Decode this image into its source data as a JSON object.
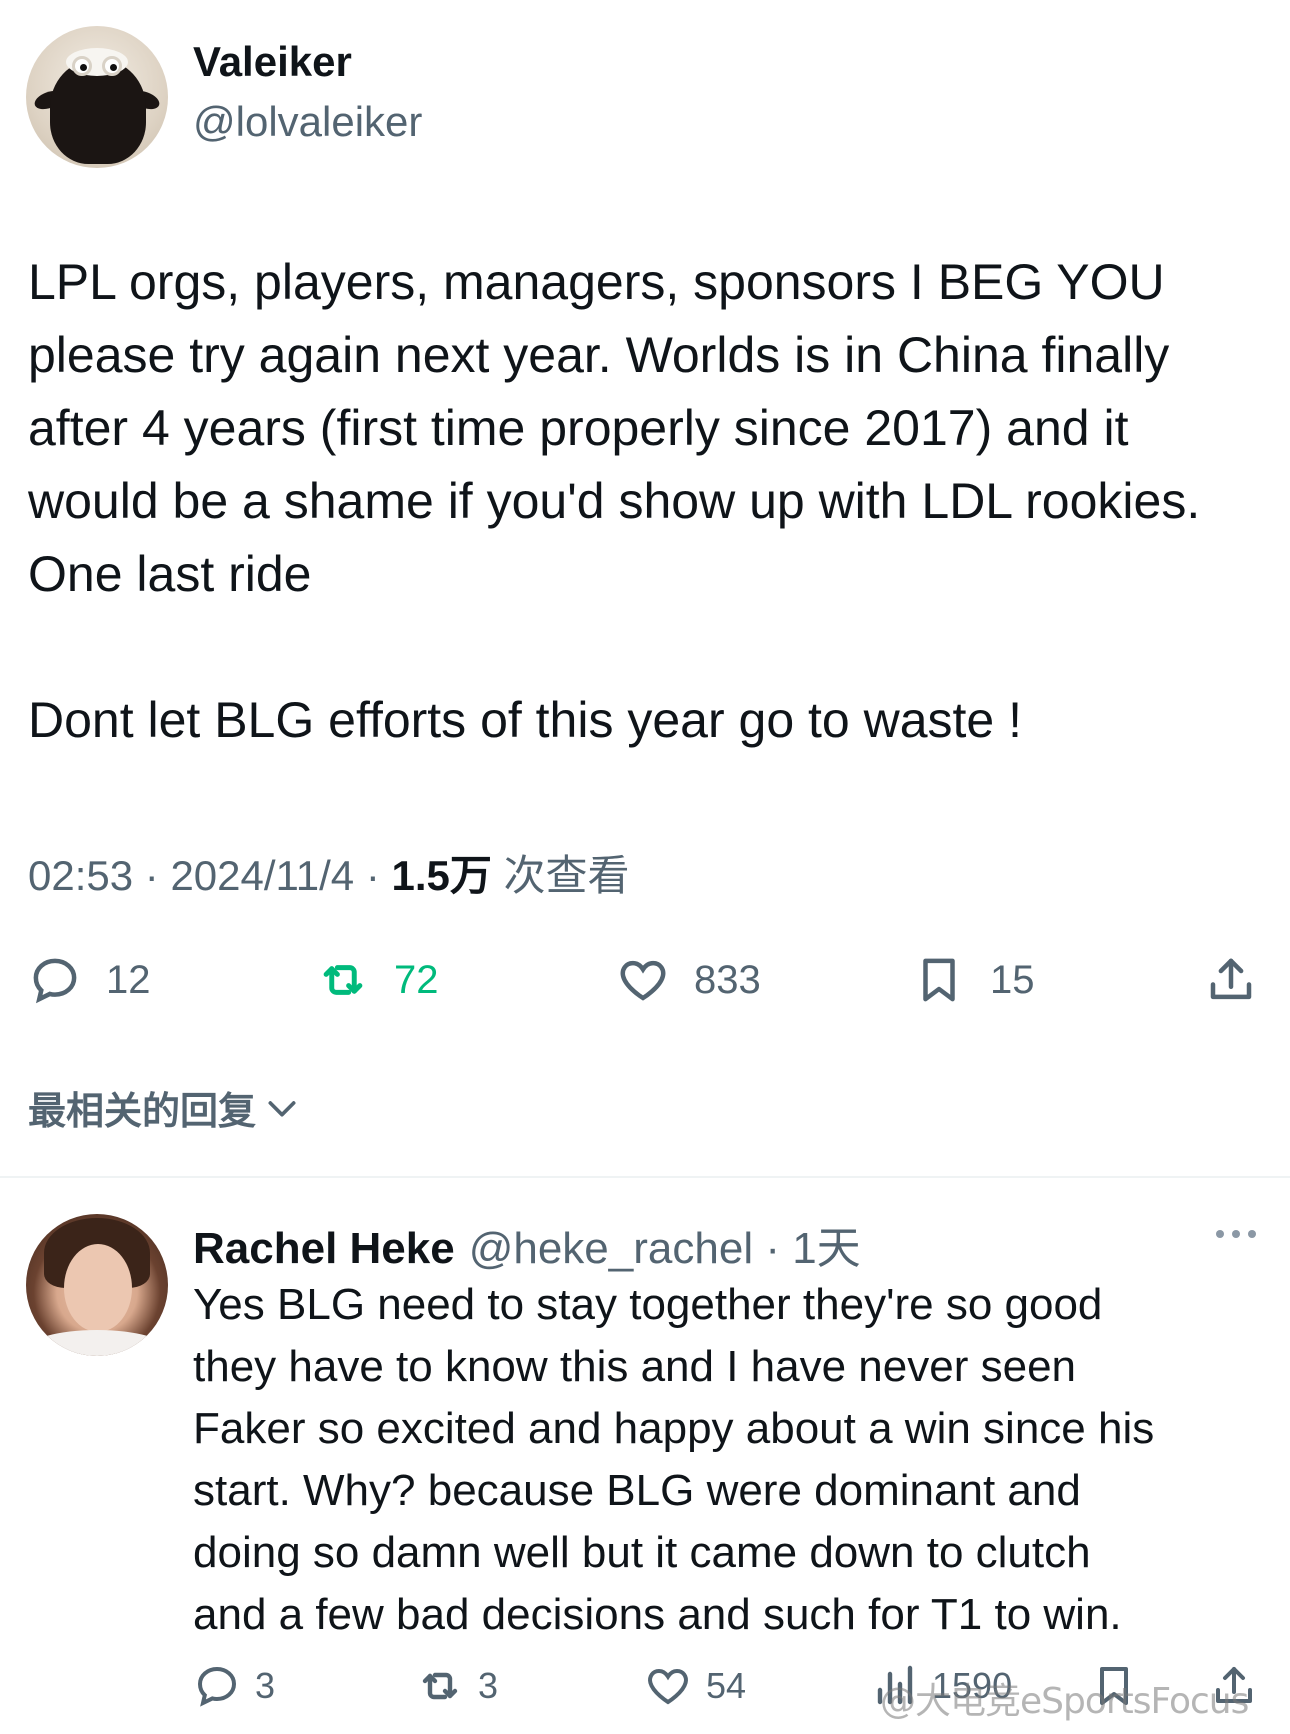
{
  "post": {
    "author": {
      "name": "Valeiker",
      "handle": "@lolvaleiker"
    },
    "text": "LPL orgs, players, managers, sponsors I BEG YOU please try again next year. Worlds is in China finally after 4 years (first time properly since 2017) and it would be a shame if you'd show up with LDL rookies. One last ride\n\nDont let BLG efforts of this year go to waste !",
    "meta": {
      "time": "02:53",
      "separator": " · ",
      "date": "2024/11/4",
      "views_count": "1.5万",
      "views_label": " 次查看"
    },
    "actions": {
      "replies": "12",
      "reposts": "72",
      "likes": "833",
      "bookmarks": "15"
    },
    "repost_color": "#00ba7c"
  },
  "replies_sort": {
    "label": "最相关的回复"
  },
  "reply": {
    "author": {
      "name": "Rachel Heke",
      "handle": "@heke_rachel"
    },
    "separator": " · ",
    "time": "1天",
    "text": "Yes BLG need to stay together they're so good\nthey have to know this  and I  have never seen\nFaker so excited and happy about a win since his\nstart. Why? because BLG were dominant and\ndoing so damn well but it came down  to clutch\nand a few bad decisions and such for T1 to win.",
    "actions": {
      "replies": "3",
      "reposts": "3",
      "likes": "54",
      "views": "1590"
    }
  },
  "watermark": "@大电竞eSportsFocus",
  "colors": {
    "text": "#0f1419",
    "muted": "#536471",
    "divider": "#eff3f4"
  }
}
